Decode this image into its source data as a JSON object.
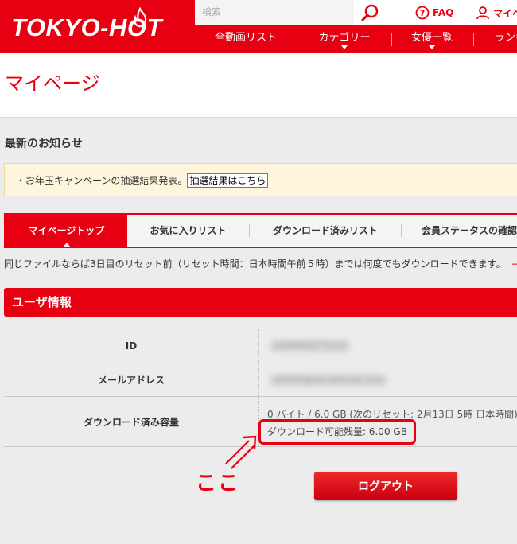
{
  "header": {
    "logo_text": "TOKYO-HOT",
    "search_placeholder": "検索",
    "faq_label": "FAQ",
    "mypage_label": "マイページ",
    "nav": [
      {
        "label": "全動画リスト"
      },
      {
        "label": "カテゴリー"
      },
      {
        "label": "女優一覧"
      },
      {
        "label": "ランキング"
      }
    ]
  },
  "page": {
    "title": "マイページ"
  },
  "notices": {
    "heading": "最新のお知らせ",
    "items": [
      {
        "text": "・お年玉キャンペーンの抽選結果発表。",
        "link": "抽選結果はこちら"
      }
    ]
  },
  "tabs": [
    {
      "label": "マイページトップ",
      "active": true
    },
    {
      "label": "お気に入りリスト",
      "active": false
    },
    {
      "label": "ダウンロード済みリスト",
      "active": false
    },
    {
      "label": "会員ステータスの確認",
      "active": false
    }
  ],
  "info_line": {
    "text": "同じファイルならば3日目のリセット前（リセット時間：日本時間午前５時）までは何度でもダウンロードできます。",
    "more": "→"
  },
  "user_info": {
    "title": "ユーザ情報",
    "rows": [
      {
        "label": "ID",
        "value": "1409900271222"
      },
      {
        "label": "メールアドレス",
        "value": "ef0000@abcdefmail.com"
      },
      {
        "label": "ダウンロード済み容量",
        "usage": "0 バイト / 6.0 GB (次のリセット: 2月13日  5時 日本時間)",
        "remaining": "ダウンロード可能残量: 6.00 GB"
      }
    ]
  },
  "annotation": {
    "text": "ここ"
  },
  "logout_label": "ログアウト",
  "colors": {
    "brand_red": "#e60012",
    "notice_bg": "#fdf6dc",
    "page_bg": "#ececec"
  }
}
